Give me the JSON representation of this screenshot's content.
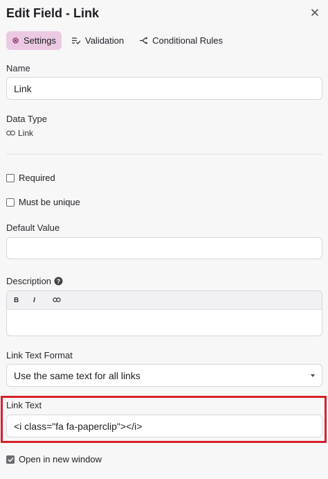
{
  "header": {
    "title": "Edit Field - Link",
    "close_icon": "close-icon"
  },
  "tabs": [
    {
      "label": "Settings",
      "icon": "gear-icon",
      "active": true
    },
    {
      "label": "Validation",
      "icon": "list-check-icon",
      "active": false
    },
    {
      "label": "Conditional Rules",
      "icon": "branch-icon",
      "active": false
    }
  ],
  "name": {
    "label": "Name",
    "value": "Link"
  },
  "data_type": {
    "label": "Data Type",
    "value": "Link",
    "icon": "link-icon"
  },
  "required": {
    "label": "Required",
    "checked": false
  },
  "unique": {
    "label": "Must be unique",
    "checked": false
  },
  "default_value": {
    "label": "Default Value",
    "value": ""
  },
  "description": {
    "label": "Description",
    "help_icon": "help-icon",
    "toolbar": {
      "bold": "B",
      "italic": "I",
      "link_icon": "link-icon"
    },
    "value": ""
  },
  "link_text_format": {
    "label": "Link Text Format",
    "selected": "Use the same text for all links"
  },
  "link_text": {
    "label": "Link Text",
    "value": "<i class=\"fa fa-paperclip\"></i>"
  },
  "open_new_window": {
    "label": "Open in new window",
    "checked": true
  },
  "colors": {
    "accent_tab": "#ecc9e2",
    "highlight": "#d71f2a"
  }
}
